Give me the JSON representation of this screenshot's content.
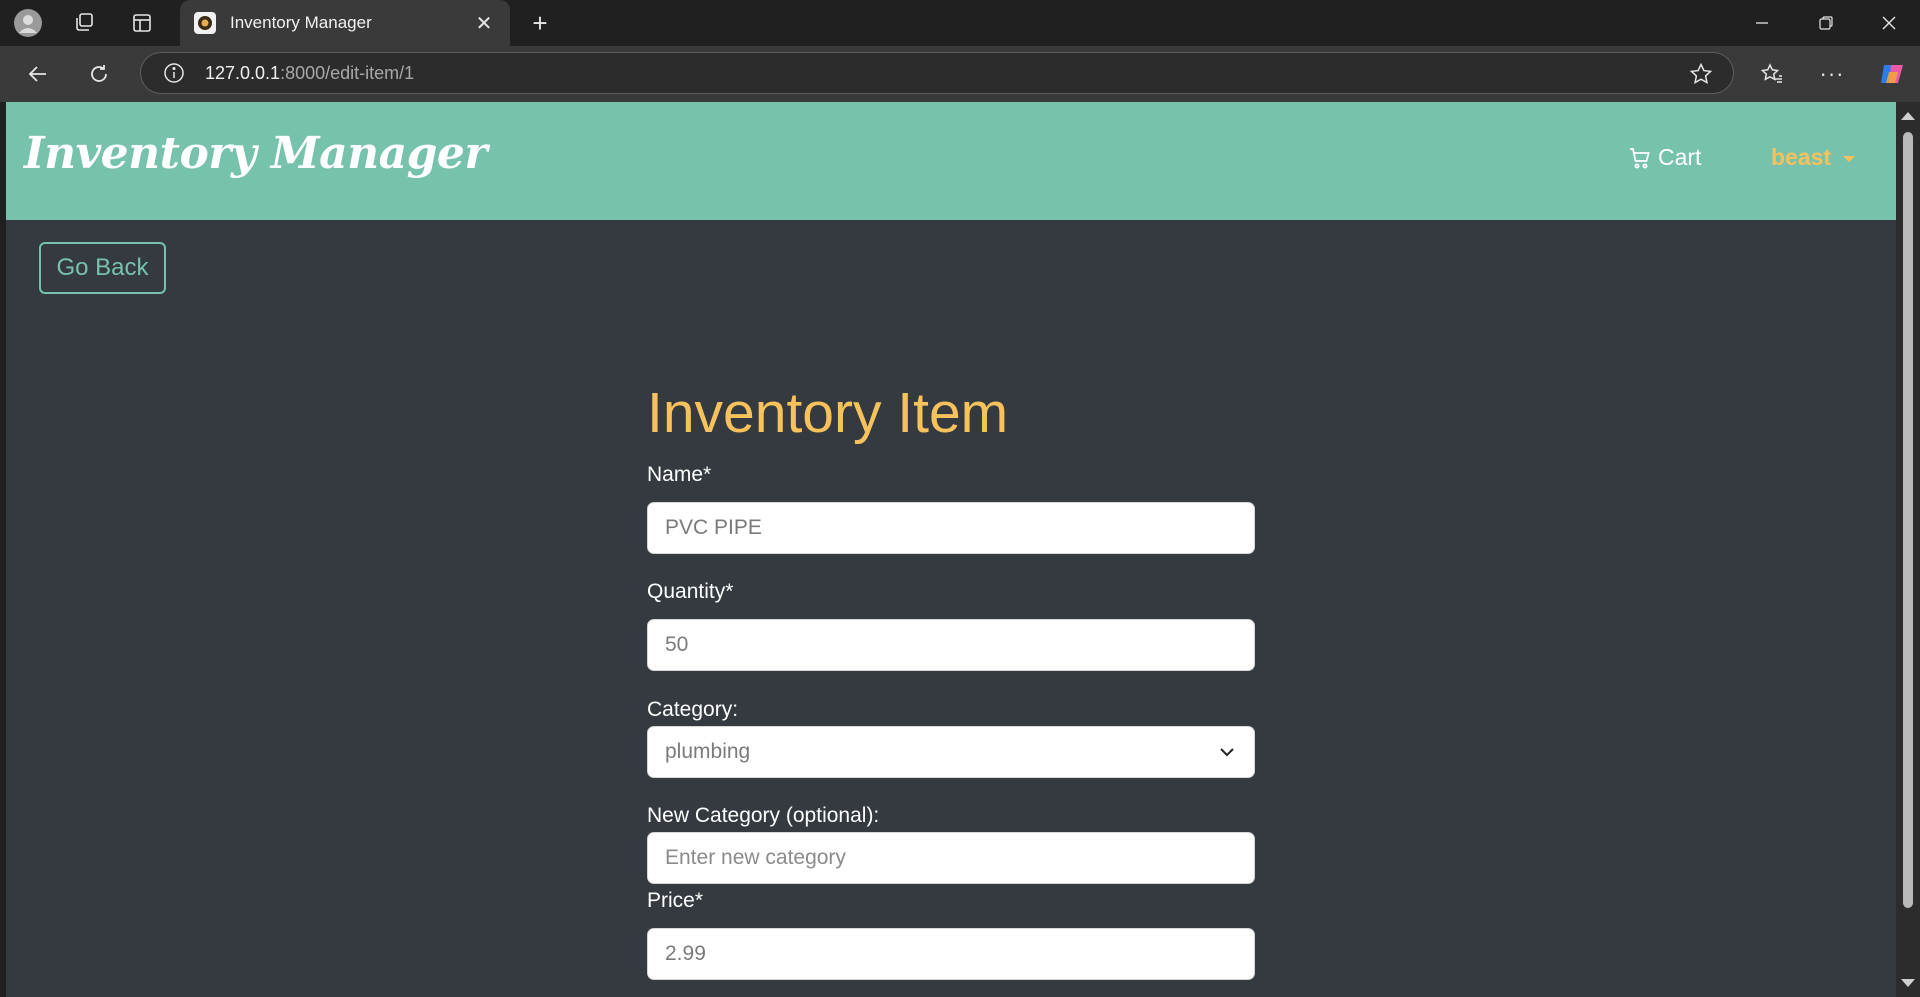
{
  "browser": {
    "tab_title": "Inventory Manager",
    "url_host": "127.0.0.1",
    "url_path": ":8000/edit-item/1"
  },
  "navbar": {
    "brand": "Inventory Manager",
    "cart_label": "Cart",
    "user_label": "beast"
  },
  "page": {
    "go_back_label": "Go Back",
    "title": "Inventory Item",
    "fields": {
      "name": {
        "label": "Name*",
        "value": "PVC PIPE"
      },
      "quantity": {
        "label": "Quantity*",
        "value": "50"
      },
      "category": {
        "label": "Category:",
        "value": "plumbing"
      },
      "new_category": {
        "label": "New Category (optional):",
        "placeholder": "Enter new category"
      },
      "price": {
        "label": "Price*",
        "value": "2.99"
      }
    }
  },
  "colors": {
    "accent_teal": "#76c2ac",
    "accent_yellow": "#f7c25b",
    "page_background": "#343a40"
  }
}
